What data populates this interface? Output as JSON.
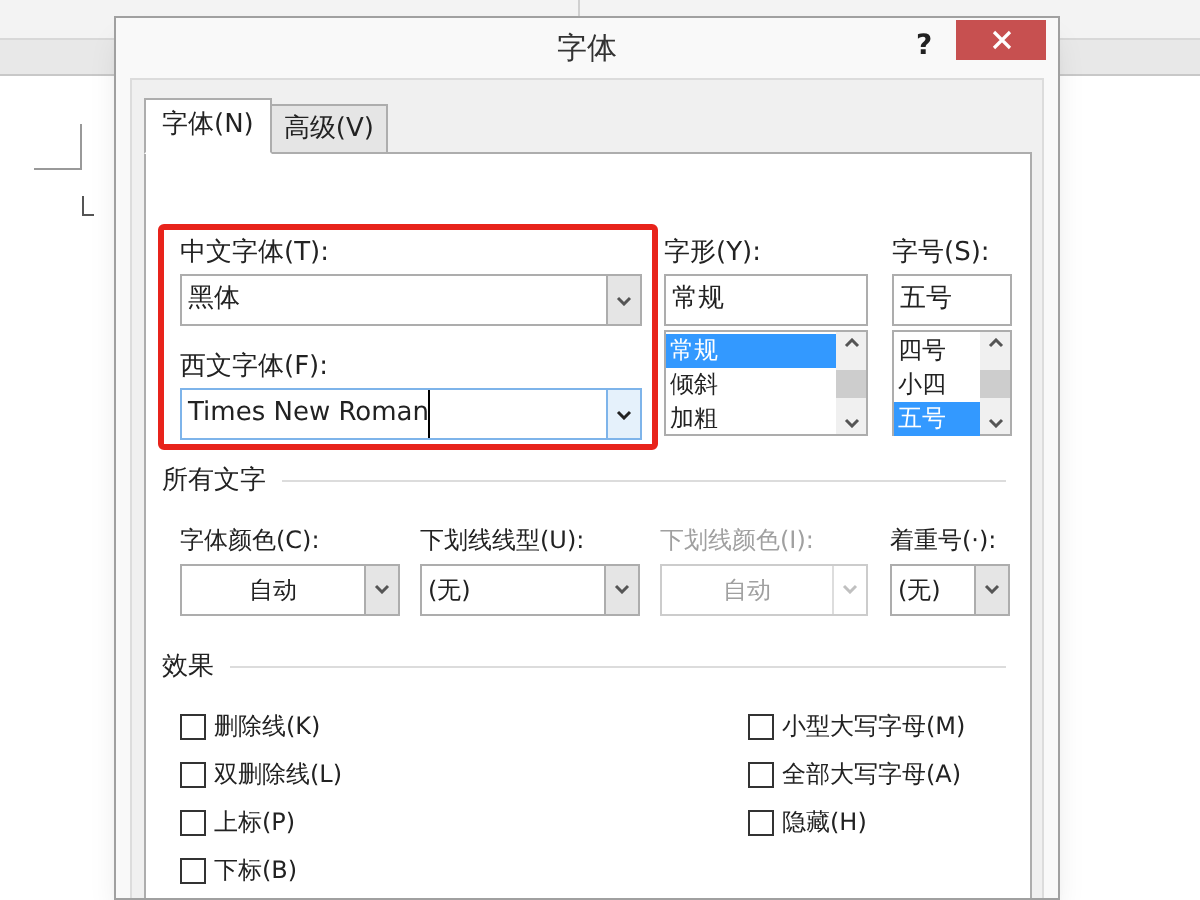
{
  "dialog": {
    "title": "字体",
    "help": "?",
    "tabs": [
      {
        "label": "字体(N)",
        "selected": true
      },
      {
        "label": "高级(V)",
        "selected": false
      }
    ],
    "fonts": [
      {
        "label": "中文字体(T):",
        "value": "黑体",
        "focused": false
      },
      {
        "label": "西文字体(F):",
        "value": "Times New Roman",
        "focused": true
      }
    ],
    "style": {
      "label": "字形(Y):",
      "value": "常规",
      "options": [
        {
          "text": "常规",
          "selected": true
        },
        {
          "text": "倾斜",
          "selected": false
        },
        {
          "text": "加粗",
          "selected": false
        }
      ]
    },
    "size": {
      "label": "字号(S):",
      "value": "五号",
      "options": [
        {
          "text": "四号",
          "selected": false
        },
        {
          "text": "小四",
          "selected": false
        },
        {
          "text": "五号",
          "selected": true
        }
      ]
    },
    "all_text": {
      "heading": "所有文字",
      "fields": [
        {
          "kind": "picker",
          "label": "字体颜色(C):",
          "value": "自动",
          "disabled": false
        },
        {
          "kind": "dropdown",
          "label": "下划线线型(U):",
          "value": "(无)",
          "disabled": false
        },
        {
          "kind": "picker",
          "label": "下划线颜色(I):",
          "value": "自动",
          "disabled": true
        },
        {
          "kind": "dropdown",
          "label": "着重号(·):",
          "value": "(无)",
          "disabled": false
        }
      ]
    },
    "effects": {
      "heading": "效果",
      "left": [
        {
          "label": "删除线(K)",
          "checked": false
        },
        {
          "label": "双删除线(L)",
          "checked": false
        },
        {
          "label": "上标(P)",
          "checked": false
        },
        {
          "label": "下标(B)",
          "checked": false
        }
      ],
      "right": [
        {
          "label": "小型大写字母(M)",
          "checked": false
        },
        {
          "label": "全部大写字母(A)",
          "checked": false
        },
        {
          "label": "隐藏(H)",
          "checked": false
        }
      ]
    }
  }
}
